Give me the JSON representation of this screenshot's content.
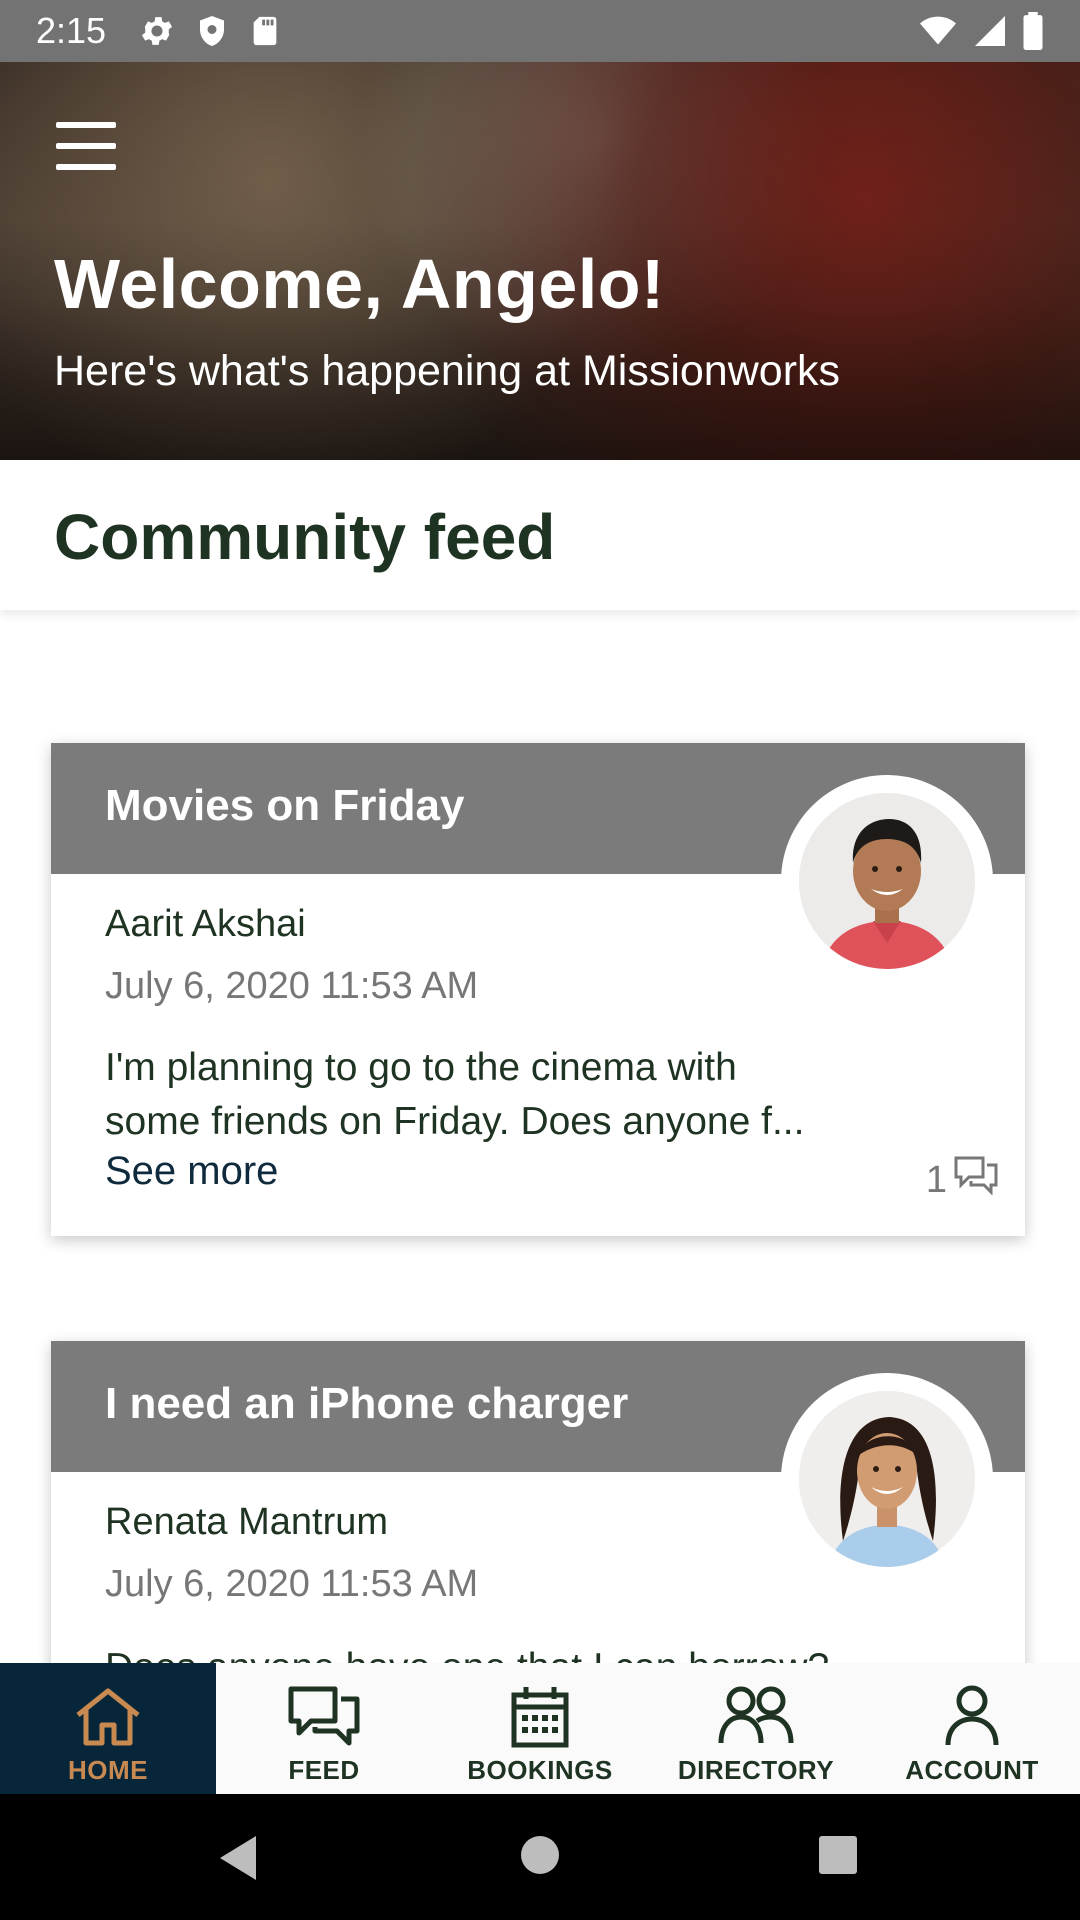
{
  "status_bar": {
    "time": "2:15",
    "left_icons": [
      "gear-icon",
      "shield-icon",
      "sd-card-icon"
    ],
    "right_icons": [
      "wifi-icon",
      "cell-signal-icon",
      "battery-icon"
    ]
  },
  "hero": {
    "title": "Welcome, Angelo!",
    "subtitle": "Here's what's happening at Missionworks"
  },
  "section": {
    "title": "Community feed"
  },
  "posts": [
    {
      "title": "Movies on Friday",
      "author": "Aarit Akshai",
      "timestamp": "July 6, 2020 11:53 AM",
      "body_line1": "I'm planning to go to the cinema with",
      "body_line2": "some friends on Friday. Does anyone f...",
      "see_more": "See more",
      "comment_count": "1"
    },
    {
      "title": "I need an iPhone charger",
      "author": "Renata Mantrum",
      "timestamp": "July 6, 2020 11:53 AM",
      "body_line1": "Does anyone have one that I can borrow?"
    }
  ],
  "bottom_nav": [
    {
      "label": "HOME",
      "icon": "home-icon",
      "active": true
    },
    {
      "label": "FEED",
      "icon": "chat-icon",
      "active": false
    },
    {
      "label": "BOOKINGS",
      "icon": "calendar-icon",
      "active": false
    },
    {
      "label": "DIRECTORY",
      "icon": "people-icon",
      "active": false
    },
    {
      "label": "ACCOUNT",
      "icon": "person-icon",
      "active": false
    }
  ],
  "colors": {
    "nav_active_bg": "#08263a",
    "nav_active_fg": "#c98a52",
    "heading": "#1f3323",
    "card_header": "#7b7b7b"
  }
}
